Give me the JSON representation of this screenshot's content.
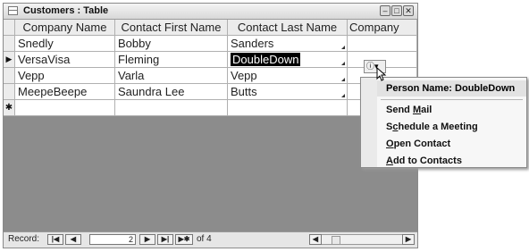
{
  "window": {
    "title": "Customers : Table"
  },
  "columns": [
    "Company Name",
    "Contact First Name",
    "Contact Last Name",
    "Company"
  ],
  "rows": [
    {
      "company": "Snedly",
      "first": "Bobby",
      "last": "Sanders"
    },
    {
      "company": "VersaVisa",
      "first": "Fleming",
      "last": "DoubleDown"
    },
    {
      "company": "Vepp",
      "first": "Varla",
      "last": "Vepp"
    },
    {
      "company": "MeepeBeepe",
      "first": "Saundra Lee",
      "last": "Butts"
    }
  ],
  "icons": {
    "current_row": "▶",
    "new_row": "✱",
    "minimize": "–",
    "restore": "□",
    "close": "✕",
    "smart_tag": "ⓘ",
    "dropdown": "▾",
    "nav_first": "|◀",
    "nav_prev": "◀",
    "nav_next": "▶",
    "nav_last": "▶|",
    "nav_new": "▶✱",
    "scroll_left": "◀",
    "scroll_right": "▶"
  },
  "statusbar": {
    "record_label": "Record:",
    "record_number": "2",
    "of_text": "of 4"
  },
  "popup": {
    "title": "Person Name: DoubleDown",
    "items": [
      {
        "pre": "Send ",
        "key": "M",
        "post": "ail"
      },
      {
        "pre": "S",
        "key": "c",
        "post": "hedule a Meeting"
      },
      {
        "pre": "",
        "key": "O",
        "post": "pen Contact"
      },
      {
        "pre": "",
        "key": "A",
        "post": "dd to Contacts"
      }
    ]
  }
}
